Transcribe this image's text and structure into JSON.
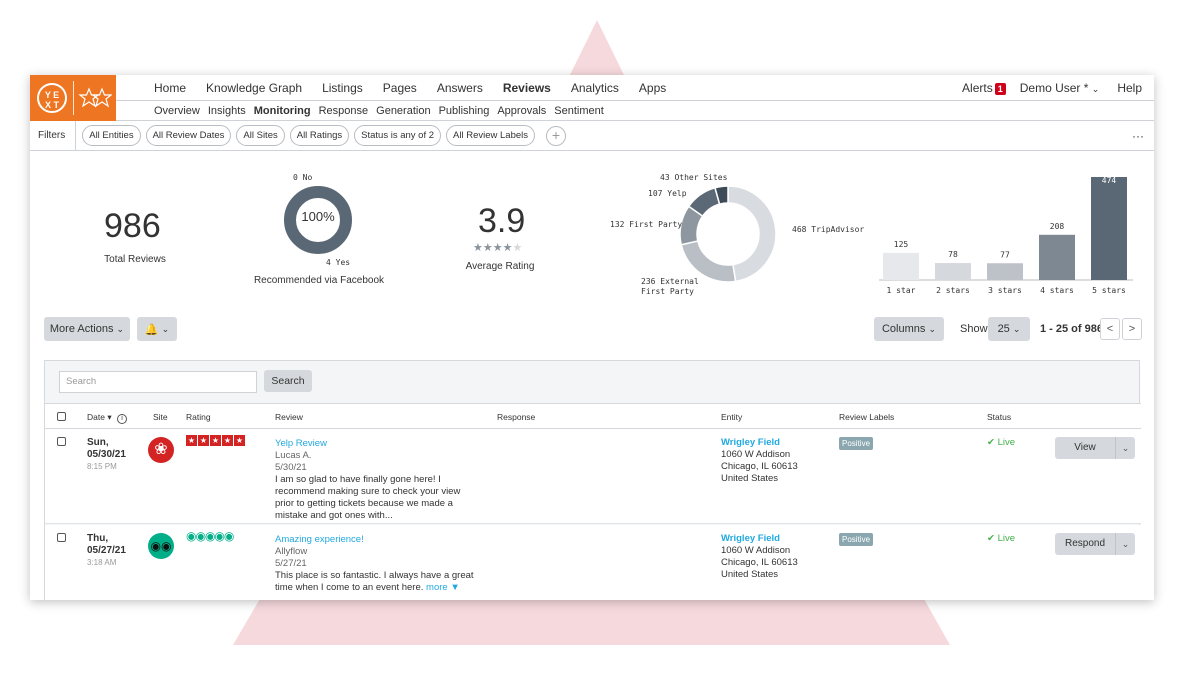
{
  "nav": {
    "logo_text": "YEXT",
    "items": [
      "Home",
      "Knowledge Graph",
      "Listings",
      "Pages",
      "Answers",
      "Reviews",
      "Analytics",
      "Apps"
    ],
    "alerts_label": "Alerts",
    "alerts_count": "1",
    "user_label": "Demo User *",
    "help_label": "Help"
  },
  "subnav": {
    "items": [
      "Overview",
      "Insights",
      "Monitoring",
      "Response",
      "Generation",
      "Publishing",
      "Approvals",
      "Sentiment"
    ]
  },
  "filters": {
    "label": "Filters",
    "chips": [
      "All Entities",
      "All Review Dates",
      "All Sites",
      "All Ratings",
      "Status is any of 2",
      "All Review Labels"
    ],
    "add_icon": "+",
    "more_icon": "···"
  },
  "stats": {
    "total_reviews": "986",
    "total_reviews_label": "Total Reviews",
    "recommended_percent": "100%",
    "recommended_no": "0 No",
    "recommended_yes": "4 Yes",
    "recommended_label": "Recommended via Facebook",
    "average_rating": "3.9",
    "average_rating_stars": "★★★★",
    "average_rating_empty_star": "★",
    "average_rating_label": "Average Rating"
  },
  "chart_data": [
    {
      "type": "pie",
      "labels": [
        "468 TripAdvisor",
        "236 External First Party",
        "132 First Party",
        "107 Yelp",
        "43 Other Sites"
      ],
      "values": [
        468,
        236,
        132,
        107,
        43
      ],
      "colors": [
        "#d8dce0",
        "#b9bfc5",
        "#8e979f",
        "#5b6875",
        "#3d4a57"
      ]
    },
    {
      "type": "bar",
      "categories": [
        "1 star",
        "2 stars",
        "3 stars",
        "4 stars",
        "5 stars"
      ],
      "values": [
        125,
        78,
        77,
        208,
        474
      ],
      "colors": [
        "#e6e8eb",
        "#d5d9dd",
        "#bcc2c8",
        "#7d8893",
        "#5a6875"
      ]
    }
  ],
  "toolbar": {
    "more_actions": "More Actions",
    "bell_icon": "bell-icon",
    "columns": "Columns",
    "show_label": "Show",
    "page_size": "25",
    "range_text": "1 - 25 of 986",
    "prev": "<",
    "next": ">"
  },
  "table": {
    "search_placeholder": "Search",
    "search_button": "Search",
    "headers": {
      "date": "Date",
      "site": "Site",
      "rating": "Rating",
      "review": "Review",
      "response": "Response",
      "entity": "Entity",
      "labels": "Review Labels",
      "status": "Status"
    },
    "rows": [
      {
        "day": "Sun,",
        "date": "05/30/21",
        "time": "8:15 PM",
        "site": "yelp",
        "site_color": "#d32323",
        "rating": 5,
        "review_title": "Yelp Review",
        "author": "Lucas A.",
        "review_date": "5/30/21",
        "review_text": "I am so glad to have finally gone here! I recommend making sure to check your view prior to getting tickets because we made a mistake and got ones with...",
        "entity_name": "Wrigley Field",
        "entity_addr1": "1060 W Addison",
        "entity_addr2": "Chicago, IL 60613",
        "entity_country": "United States",
        "label": "Positive",
        "status": "✔ Live",
        "action": "View"
      },
      {
        "day": "Thu,",
        "date": "05/27/21",
        "time": "3:18 AM",
        "site": "tripadvisor",
        "site_color": "#00af87",
        "rating": 5,
        "review_title": "Amazing experience!",
        "author": "Allyflow",
        "review_date": "5/27/21",
        "review_text": "This place is so fantastic. I always have a great time when I come to an event here.",
        "more_link": "more ▼",
        "entity_name": "Wrigley Field",
        "entity_addr1": "1060 W Addison",
        "entity_addr2": "Chicago, IL 60613",
        "entity_country": "United States",
        "label": "Positive",
        "status": "✔ Live",
        "action": "Respond"
      }
    ]
  }
}
